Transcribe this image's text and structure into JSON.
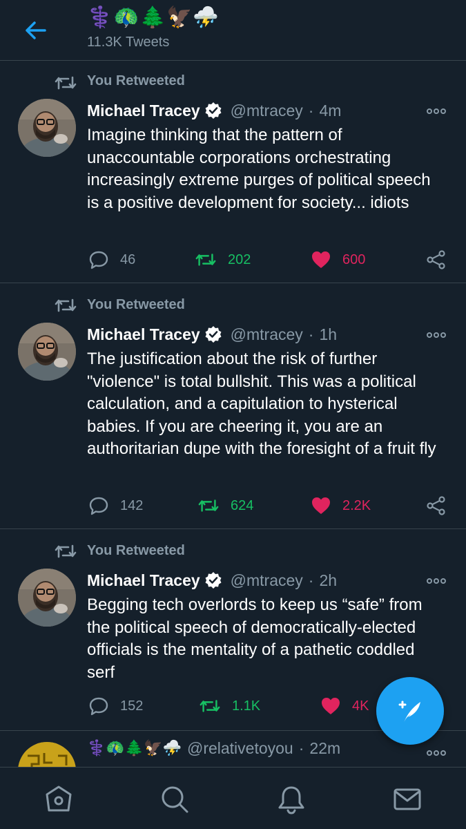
{
  "header": {
    "title": "⚕️🦚🌲🦅⛈️",
    "tweet_count": "11.3K Tweets"
  },
  "tweets": [
    {
      "retweet_label": "You Retweeted",
      "name": "Michael Tracey",
      "handle": "@mtracey",
      "separator": "·",
      "time": "4m",
      "text": "Imagine thinking that the pattern of unaccountable corporations orchestrating increasingly extreme purges of political speech is a positive development for society... idiots",
      "replies": "46",
      "retweets": "202",
      "likes": "600"
    },
    {
      "retweet_label": "You Retweeted",
      "name": "Michael Tracey",
      "handle": "@mtracey",
      "separator": "·",
      "time": "1h",
      "text": "The justification about the risk of further \"violence\" is total bullshit. This was a political calculation, and a capitulation to hysterical babies. If you are cheering it, you are an authoritarian dupe with the foresight of a fruit fly",
      "replies": "142",
      "retweets": "624",
      "likes": "2.2K"
    },
    {
      "retweet_label": "You Retweeted",
      "name": "Michael Tracey",
      "handle": "@mtracey",
      "separator": "·",
      "time": "2h",
      "text": "Begging tech overlords to keep us “safe” from the political speech of democratically-elected officials is the mentality of a pathetic coddled serf",
      "replies": "152",
      "retweets": "1.1K",
      "likes": "4K"
    }
  ],
  "partial_tweet": {
    "display_name": "⚕️🦚🌲🦅⛈️",
    "handle": "@relativetoyou",
    "separator": "·",
    "time": "22m"
  },
  "icons": {
    "back": "arrow-left-icon",
    "retweet": "retweet-icon",
    "verified": "verified-badge-icon",
    "more": "more-options-icon",
    "reply": "reply-icon",
    "like": "heart-icon",
    "share": "share-icon",
    "compose": "compose-quill-icon",
    "home": "home-icon",
    "search": "search-icon",
    "notifications": "bell-icon",
    "messages": "mail-icon"
  },
  "colors": {
    "background": "#15202b",
    "accent": "#1da1f2",
    "retweet_green": "#17bf63",
    "like_red": "#e0245e",
    "secondary_text": "#8899a6",
    "divider": "#38444d"
  }
}
